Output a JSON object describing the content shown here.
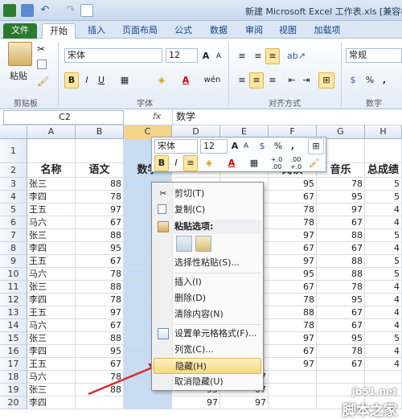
{
  "window": {
    "title": "新建 Microsoft Excel 工作表.xls [兼容模式]",
    "quick_access": [
      "save-icon",
      "undo-icon",
      "redo-icon",
      "customize-icon"
    ]
  },
  "ribbon_tabs": [
    "文件",
    "开始",
    "插入",
    "页面布局",
    "公式",
    "数据",
    "审阅",
    "视图",
    "加载项"
  ],
  "ribbon": {
    "clipboard": {
      "paste": "粘贴",
      "label": "剪贴板"
    },
    "font": {
      "name": "宋体",
      "size": "12",
      "grow": "A",
      "shrink": "A",
      "bold": "B",
      "italic": "I",
      "underline": "U",
      "pinyin": "wén",
      "label": "字体"
    },
    "alignment": {
      "label": "对齐方式"
    },
    "number": {
      "format": "常规",
      "percent": "%",
      "comma": ",",
      "label": "数字"
    }
  },
  "formula_bar": {
    "name_box": "C2",
    "fx": "fx",
    "value": "数学"
  },
  "columns": [
    "A",
    "B",
    "C",
    "D",
    "E",
    "F",
    "G",
    "H"
  ],
  "rows": {
    "numbers": [
      "1",
      "2",
      "3",
      "4",
      "5",
      "6",
      "7",
      "8",
      "9",
      "10",
      "11",
      "12",
      "13",
      "14",
      "15",
      "16",
      "17",
      "18",
      "19",
      "20"
    ],
    "headers": [
      "名称",
      "语文",
      "数学",
      "",
      "",
      "阅读",
      "音乐",
      "总成绩"
    ],
    "names": [
      "张三",
      "李四",
      "王五",
      "马六",
      "张三",
      "李四",
      "王五",
      "马六",
      "张三",
      "李四",
      "王五",
      "马六",
      "张三",
      "李四",
      "王五",
      "马六",
      "张三",
      "李四"
    ],
    "col_b": [
      "88",
      "78",
      "97",
      "67",
      "88",
      "95",
      "67",
      "78",
      "88",
      "78",
      "97",
      "67",
      "88",
      "95",
      "67",
      "78",
      "88",
      ""
    ],
    "col_d": [
      "",
      "",
      "",
      "",
      "",
      "",
      "",
      "",
      "",
      "",
      "",
      "",
      "",
      "",
      "",
      "97",
      "95",
      "97"
    ],
    "col_e": [
      "",
      "",
      "",
      "",
      "",
      "",
      "",
      "",
      "",
      "",
      "",
      "",
      "",
      "",
      "",
      "67",
      "67",
      "97"
    ],
    "col_f": [
      "95",
      "67",
      "78",
      "78",
      "97",
      "67",
      "97",
      "95",
      "67",
      "78",
      "88",
      "78",
      "97",
      "67",
      "97",
      "",
      "",
      ""
    ],
    "col_g": [
      "78",
      "95",
      "97",
      "67",
      "88",
      "67",
      "88",
      "88",
      "78",
      "95",
      "67",
      "67",
      "95",
      "78",
      "67",
      "",
      "",
      ""
    ],
    "col_h": [
      "5",
      "5",
      "4",
      "4",
      "5",
      "4",
      "5",
      "5",
      "4",
      "4",
      "4",
      "4",
      "5",
      "4",
      "4",
      "",
      "",
      ""
    ]
  },
  "mini_toolbar": {
    "font": "宋体",
    "size": "12",
    "grow": "A",
    "shrink": "A",
    "percent": "%",
    "comma": ",",
    "bold": "B",
    "italic": "I",
    "decimals_inc": "+.0\n.00",
    "decimals_dec": ".00\n+.0"
  },
  "context_menu": {
    "items": [
      {
        "label": "剪切(T)",
        "icon": "scissors-icon"
      },
      {
        "label": "复制(C)",
        "icon": "copy-icon"
      },
      {
        "label": "粘贴选项:",
        "icon": "paste-options-icon",
        "title": true
      },
      {
        "label": "选择性粘贴(S)...",
        "icon": ""
      },
      {
        "label": "插入(I)",
        "icon": ""
      },
      {
        "label": "删除(D)",
        "icon": ""
      },
      {
        "label": "清除内容(N)",
        "icon": ""
      },
      {
        "label": "设置单元格格式(F)...",
        "icon": "format-cells-icon"
      },
      {
        "label": "列宽(C)...",
        "icon": ""
      },
      {
        "label": "隐藏(H)",
        "icon": "",
        "highlighted": true
      },
      {
        "label": "取消隐藏(U)",
        "icon": ""
      }
    ]
  },
  "watermark": {
    "site": "jb51.net",
    "name": "脚本之家"
  },
  "colors": {
    "file_tab": "#2a7a2f",
    "highlight": "#f8d97d",
    "selection": "#c7dcf2",
    "arrow": "#d62b2b"
  }
}
